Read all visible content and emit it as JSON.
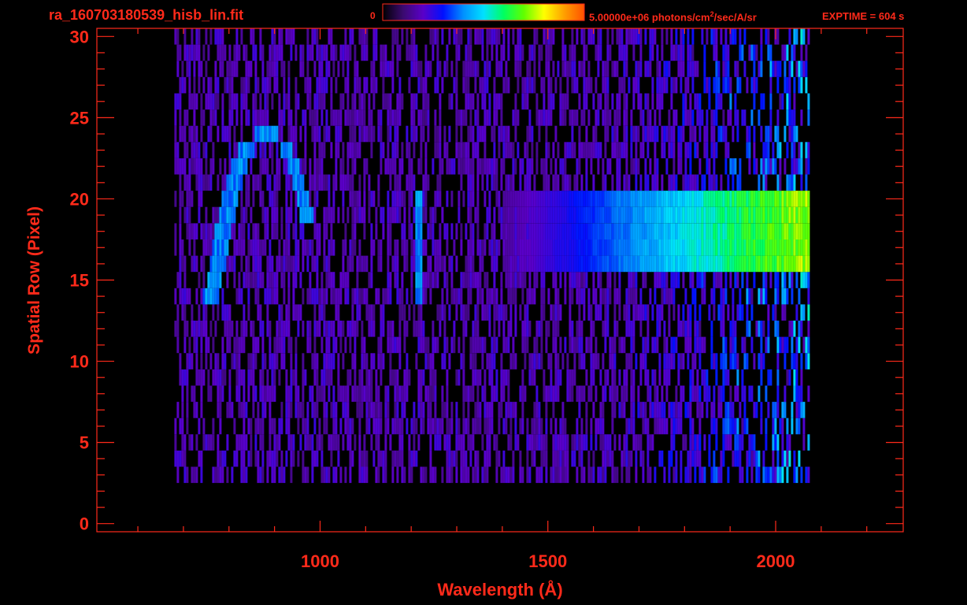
{
  "header": {
    "filename": "ra_160703180539_hisb_lin.fit",
    "exptime": "EXPTIME = 604 s"
  },
  "colorbar": {
    "min_label": "0",
    "max_value": "5.00000e+06",
    "max_units_pre": "photons/cm",
    "max_units_sup": "2",
    "max_units_post": "/sec/A/sr",
    "colors": [
      "#000000",
      "#3a0a6e",
      "#5a00c8",
      "#0010ff",
      "#0090ff",
      "#00e0ff",
      "#00ff60",
      "#60ff00",
      "#ffff00",
      "#ffa000",
      "#ff5000"
    ]
  },
  "chart_data": {
    "type": "heatmap",
    "xlabel": "Wavelength (Å)",
    "ylabel": "Spatial Row (Pixel)",
    "xlim": [
      510,
      2280
    ],
    "ylim": [
      -0.5,
      30.5
    ],
    "xticks": [
      1000,
      1500,
      2000
    ],
    "yticks": [
      0,
      5,
      10,
      15,
      20,
      25,
      30
    ],
    "x_minor_step": 100,
    "y_minor_step": 1,
    "signal_x_range": [
      680,
      2070
    ],
    "signal_y_range": [
      3,
      30
    ],
    "bright_band": {
      "x_start": 1650,
      "x_end": 2070,
      "y_range": [
        16,
        20
      ],
      "peak_level": 0.65
    },
    "arc_feature": {
      "x_center": 890,
      "x_half_width": 110,
      "y_range": [
        14,
        24
      ],
      "level": 0.45
    },
    "line_feature": {
      "x": 1215,
      "y_range": [
        14,
        20
      ],
      "level": 0.45
    },
    "frame_color": "#ff2a1a"
  }
}
